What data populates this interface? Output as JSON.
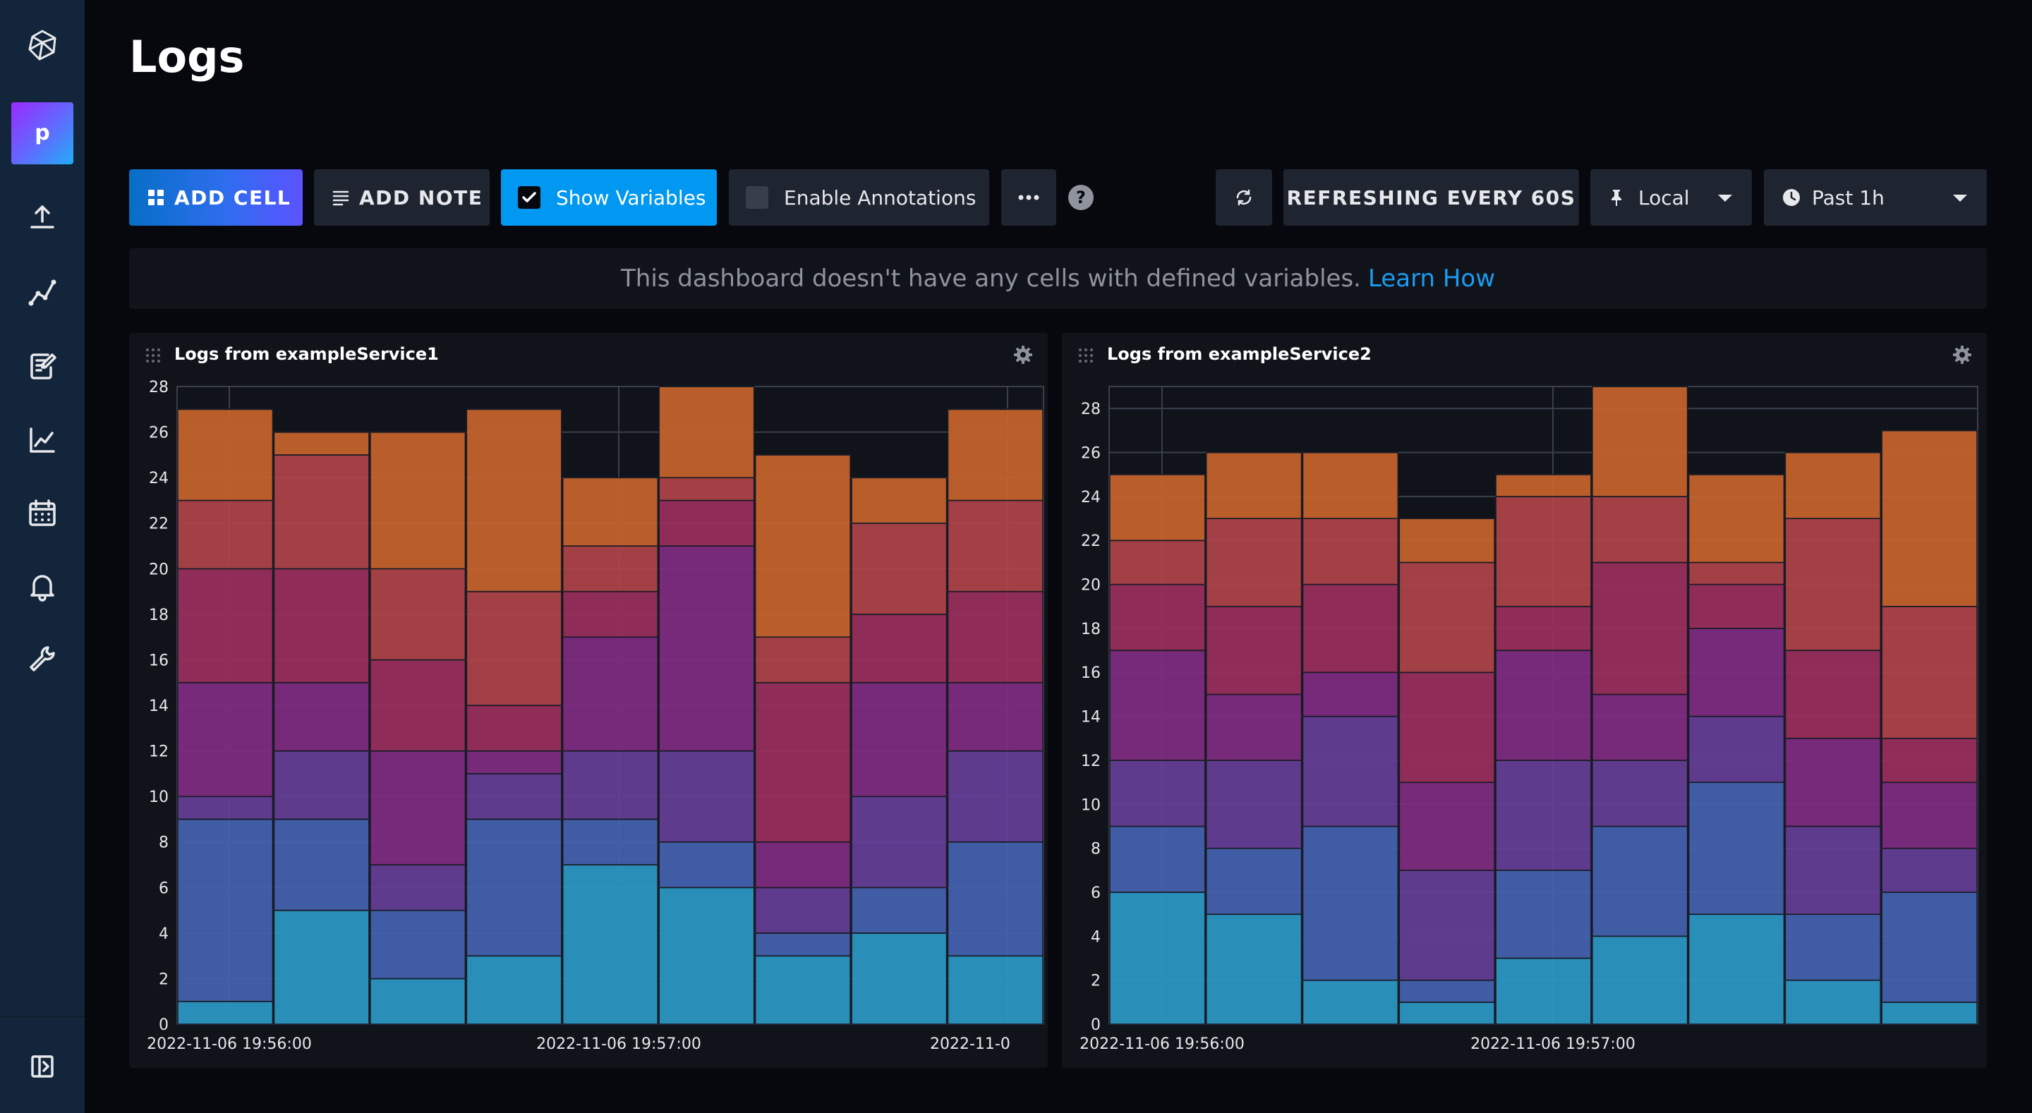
{
  "sidebar": {
    "org_initial": "p",
    "items": [
      {
        "name": "upload-icon",
        "label": "Load Data"
      },
      {
        "name": "data-explorer-icon",
        "label": "Data Explorer"
      },
      {
        "name": "notebook-icon",
        "label": "Notebooks"
      },
      {
        "name": "dashboards-icon",
        "label": "Dashboards"
      },
      {
        "name": "tasks-icon",
        "label": "Tasks"
      },
      {
        "name": "alerts-icon",
        "label": "Alerts"
      },
      {
        "name": "settings-wrench-icon",
        "label": "Settings"
      }
    ],
    "collapse_icon": "collapse-sidebar-icon"
  },
  "page": {
    "title": "Logs"
  },
  "toolbar": {
    "add_cell": "ADD CELL",
    "add_note": "ADD NOTE",
    "show_variables": "Show Variables",
    "show_variables_checked": true,
    "enable_annotations": "Enable Annotations",
    "enable_annotations_checked": false,
    "more": "···",
    "refreshing": "REFRESHING EVERY 60S",
    "timezone": "Local",
    "time_range": "Past 1h"
  },
  "banner": {
    "text": "This dashboard doesn't have any cells with defined variables.",
    "link": "Learn How"
  },
  "colors": {
    "series": [
      "#2b99c5",
      "#4463b0",
      "#663f98",
      "#802b82",
      "#9a2f5c",
      "#b0444a",
      "#c8642b"
    ]
  },
  "cells": [
    {
      "title": "Logs from exampleService1",
      "chart_data": {
        "type": "bar",
        "stacked": true,
        "ylim": [
          0,
          28
        ],
        "yticks": [
          0,
          2,
          4,
          6,
          8,
          10,
          12,
          14,
          16,
          18,
          20,
          22,
          24,
          26,
          28
        ],
        "x_tick_labels": [
          "2022-11-06 19:56:00",
          "2022-11-06 19:57:00",
          "2022-11-0"
        ],
        "totals": [
          [
            1,
            9,
            10,
            15,
            20,
            23,
            27
          ],
          [
            5,
            9,
            12,
            15,
            20,
            25,
            26
          ],
          [
            2,
            5,
            7,
            12,
            16,
            20,
            26
          ],
          [
            3,
            9,
            11,
            12,
            14,
            19,
            27
          ],
          [
            7,
            9,
            12,
            17,
            19,
            21,
            24
          ],
          [
            6,
            8,
            12,
            21,
            23,
            24,
            28
          ],
          [
            3,
            4,
            6,
            8,
            15,
            17,
            25
          ],
          [
            4,
            6,
            10,
            15,
            18,
            22,
            24
          ],
          [
            3,
            8,
            12,
            15,
            19,
            23,
            27
          ]
        ]
      }
    },
    {
      "title": "Logs from exampleService2",
      "chart_data": {
        "type": "bar",
        "stacked": true,
        "ylim": [
          0,
          29
        ],
        "yticks": [
          0,
          2,
          4,
          6,
          8,
          10,
          12,
          14,
          16,
          18,
          20,
          22,
          24,
          26,
          28
        ],
        "x_tick_labels": [
          "2022-11-06 19:56:00",
          "2022-11-06 19:57:00"
        ],
        "totals": [
          [
            6,
            9,
            12,
            17,
            20,
            22,
            25
          ],
          [
            5,
            8,
            12,
            15,
            19,
            23,
            26
          ],
          [
            2,
            9,
            14,
            16,
            20,
            23,
            26
          ],
          [
            1,
            2,
            7,
            11,
            16,
            21,
            23
          ],
          [
            3,
            7,
            12,
            17,
            19,
            24,
            25
          ],
          [
            4,
            9,
            12,
            15,
            21,
            24,
            29
          ],
          [
            5,
            11,
            14,
            18,
            20,
            21,
            25
          ],
          [
            2,
            5,
            9,
            13,
            17,
            23,
            26
          ],
          [
            1,
            6,
            8,
            11,
            13,
            19,
            27
          ]
        ]
      }
    }
  ]
}
